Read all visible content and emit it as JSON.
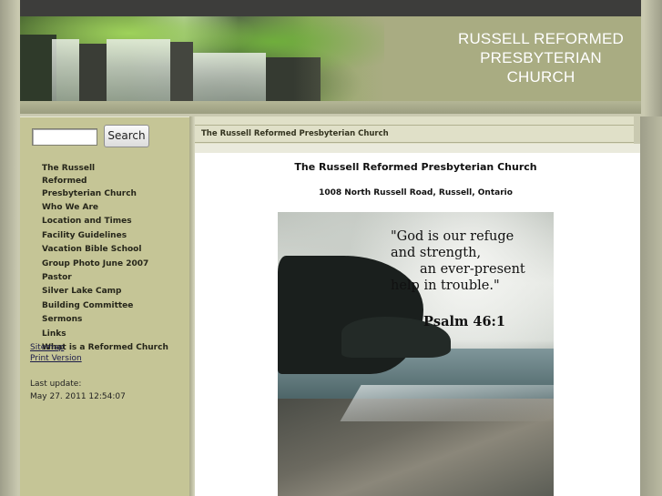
{
  "header": {
    "site_title_line1": "RUSSELL REFORMED",
    "site_title_line2": "PRESBYTERIAN",
    "site_title_line3": "CHURCH"
  },
  "search": {
    "input_value": "",
    "button_label": "Search"
  },
  "sidebar": {
    "items": [
      {
        "label": "The Russell Reformed Presbyterian Church"
      },
      {
        "label": "Who We Are"
      },
      {
        "label": "Location and Times"
      },
      {
        "label": "Facility Guidelines"
      },
      {
        "label": "Vacation Bible School"
      },
      {
        "label": "Group Photo June 2007"
      },
      {
        "label": "Pastor"
      },
      {
        "label": "Silver Lake Camp"
      },
      {
        "label": "Building Committee"
      },
      {
        "label": "Sermons"
      },
      {
        "label": "Links"
      },
      {
        "label": "What is a Reformed Church"
      }
    ],
    "sitemap_label": "Sitemap",
    "print_label": "Print Version",
    "last_update_label": "Last update:",
    "last_update_value": "May 27. 2011 12:54:07"
  },
  "breadcrumb": "The Russell Reformed Presbyterian Church",
  "main": {
    "heading": "The Russell Reformed Presbyterian Church",
    "address": "1008 North Russell Road, Russell, Ontario",
    "verse_line1": "\"God is our refuge",
    "verse_line2": "and strength,",
    "verse_line3": "an ever-present",
    "verse_line4": "help in trouble.\"",
    "verse_reference": "Psalm 46:1"
  }
}
